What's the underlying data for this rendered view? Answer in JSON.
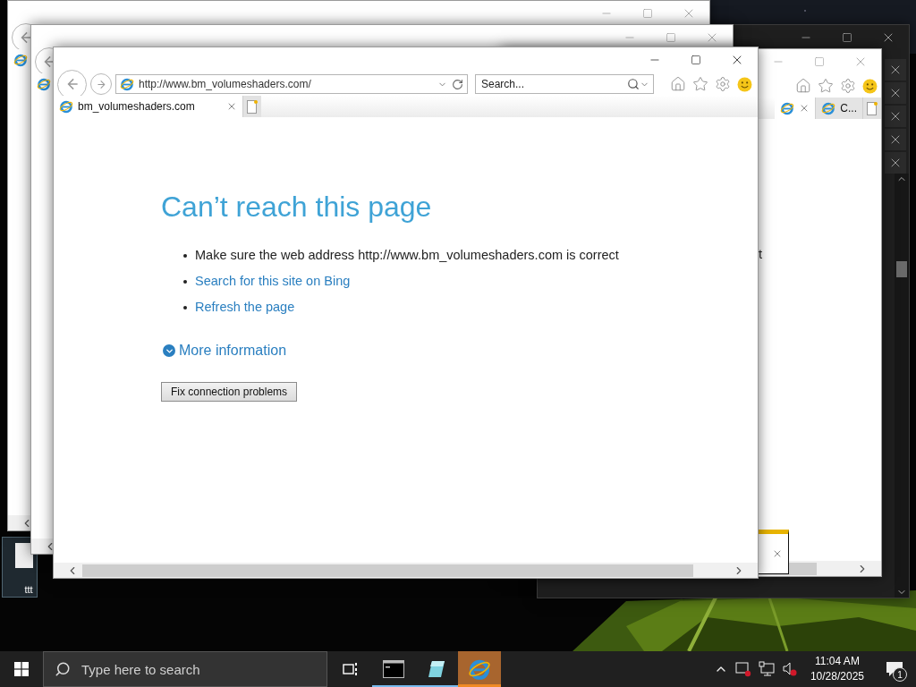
{
  "desktop": {
    "icons": [
      {
        "label": "ttt",
        "selected": true
      }
    ]
  },
  "right_window": {
    "tabs": [
      {
        "selected": true
      },
      {
        "label": "C...",
        "selected": false
      }
    ],
    "page_text_fragment": "t"
  },
  "browser": {
    "address": "http://www.bm_volumeshaders.com/",
    "search_placeholder": "Search...",
    "tabs": [
      {
        "label": "bm_volumeshaders.com",
        "selected": true
      }
    ],
    "page": {
      "heading": "Can’t reach this page",
      "items": [
        {
          "kind": "text",
          "text": "Make sure the web address http://www.bm_volumeshaders.com is correct"
        },
        {
          "kind": "link",
          "text": "Search for this site on Bing"
        },
        {
          "kind": "link",
          "text": "Refresh the page"
        }
      ],
      "more_info": {
        "label": "More information",
        "expanded": false
      },
      "button": "Fix connection problems"
    }
  },
  "taskbar": {
    "search_placeholder": "Type here to search",
    "apps": [
      {
        "kind": "terminal",
        "running": true,
        "selected": false
      },
      {
        "kind": "notes",
        "running": true,
        "selected": false
      },
      {
        "kind": "browser",
        "running": true,
        "selected": true
      }
    ],
    "clock": {
      "time": "11:04 AM",
      "date": "10/28/2025"
    },
    "notification_count": "1"
  }
}
